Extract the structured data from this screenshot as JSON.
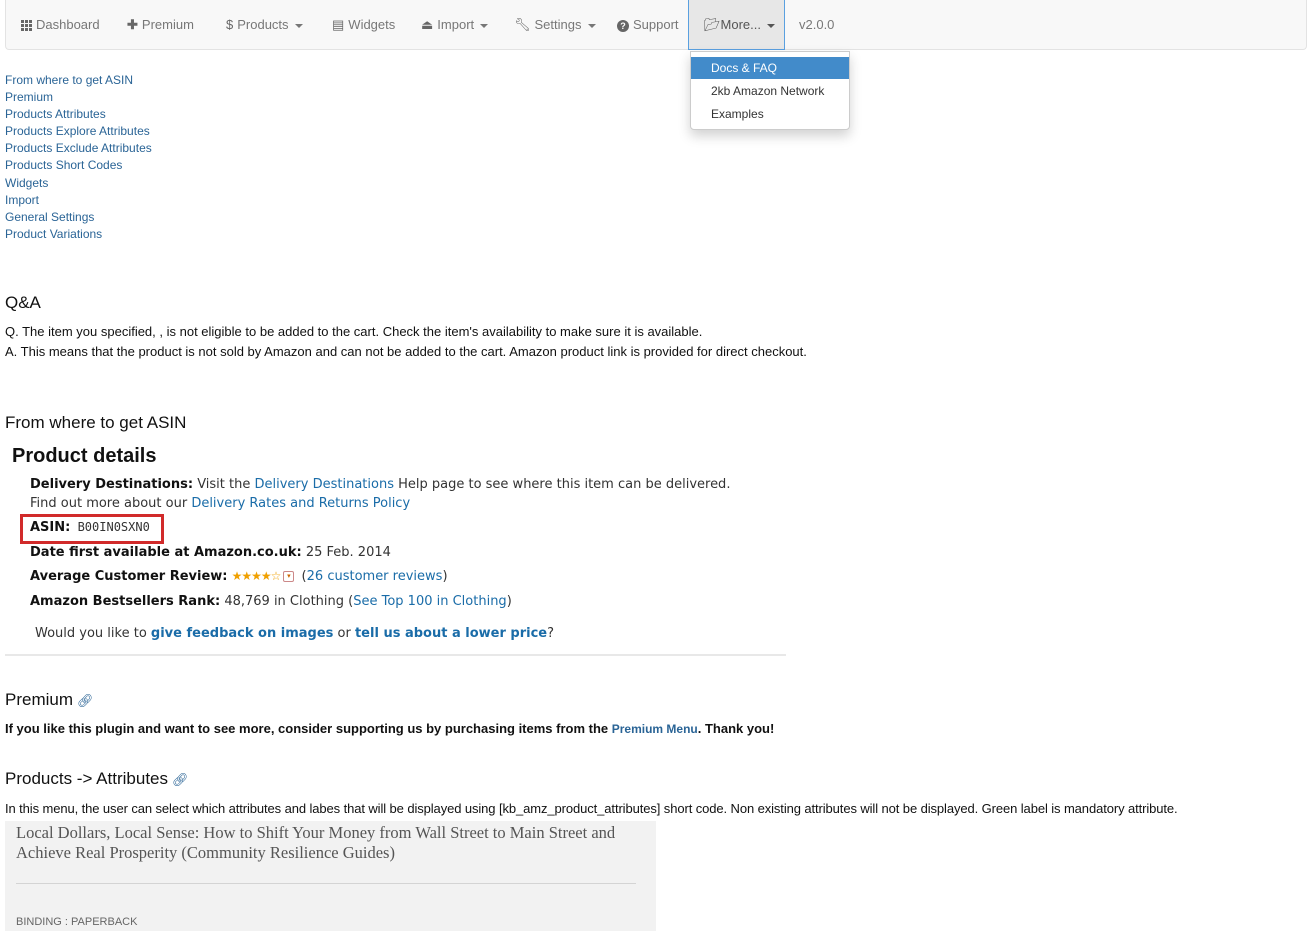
{
  "nav": {
    "dashboard": "Dashboard",
    "premium": "Premium",
    "products": "Products",
    "widgets": "Widgets",
    "import": "Import",
    "settings": "Settings",
    "support": "Support",
    "more": "More...",
    "version": "v2.0.0",
    "icons": {
      "dashboard": "grid-icon",
      "premium": "plus-icon",
      "products": "dollar-icon",
      "widgets": "list-icon",
      "import": "import-icon",
      "settings": "wrench-icon",
      "support": "question-circle-icon",
      "more": "folder-open-icon"
    }
  },
  "dropdown": {
    "items": [
      "Docs & FAQ",
      "2kb Amazon Network",
      "Examples"
    ],
    "active_index": 0
  },
  "toc": [
    "From where to get ASIN",
    "Premium",
    "Products Attributes",
    "Products Explore Attributes",
    "Products Exclude Attributes",
    "Products Short Codes",
    "Widgets",
    "Import",
    "General Settings",
    "Product Variations"
  ],
  "qa": {
    "heading": "Q&A",
    "question": "Q. The item you specified, , is not eligible to be added to the cart. Check the item's availability to make sure it is available.",
    "answer": "A. This means that the product is not sold by Amazon and can not be added to the cart. Amazon product link is provided for direct checkout."
  },
  "asin_section": {
    "heading": "From where to get ASIN",
    "image": {
      "title": "Product details",
      "delivery_label": "Delivery Destinations:",
      "delivery_pre": " Visit the ",
      "delivery_link": "Delivery Destinations",
      "delivery_post": " Help page to see where this item can be delivered.",
      "rates_pre": "Find out more about our ",
      "rates_link": "Delivery Rates and Returns Policy",
      "asin_label": "ASIN:",
      "asin_value": " B00IN0SXN0",
      "date_label": "Date first available at Amazon.co.uk:",
      "date_value": " 25 Feb. 2014",
      "review_label": "Average Customer Review:",
      "review_stars": "★★★★☆",
      "review_open": " (",
      "review_link": "26 customer reviews",
      "review_close": ")",
      "rank_label": "Amazon Bestsellers Rank:",
      "rank_value": " 48,769 in Clothing (",
      "rank_link": "See Top 100 in Clothing",
      "rank_close": ")",
      "feedback_pre": "Would you like to ",
      "feedback_link1": "give feedback on images",
      "feedback_mid": " or ",
      "feedback_link2": "tell us about a lower price",
      "feedback_post": "?"
    }
  },
  "premium_section": {
    "heading": "Premium",
    "text_pre": "If you like this plugin and want to see more, consider supporting us by purchasing items from the ",
    "text_link": "Premium Menu",
    "text_post": ". Thank you!"
  },
  "attributes_section": {
    "heading": "Products -> Attributes",
    "text": "In this menu, the user can select which attributes and labes that will be displayed using [kb_amz_product_attributes] short code. Non existing attributes will not be displayed. Green label is mandatory attribute.",
    "image": {
      "book_title": "Local Dollars, Local Sense: How to Shift Your Money from Wall Street to Main Street and Achieve Real Prosperity (Community Resilience Guides)",
      "binding": "BINDING : PAPERBACK"
    }
  },
  "colors": {
    "link": "#2a6496",
    "dropdown_active": "#428bca",
    "asin_highlight": "#d12a2a",
    "navbar_bg": "#f8f8f8"
  }
}
